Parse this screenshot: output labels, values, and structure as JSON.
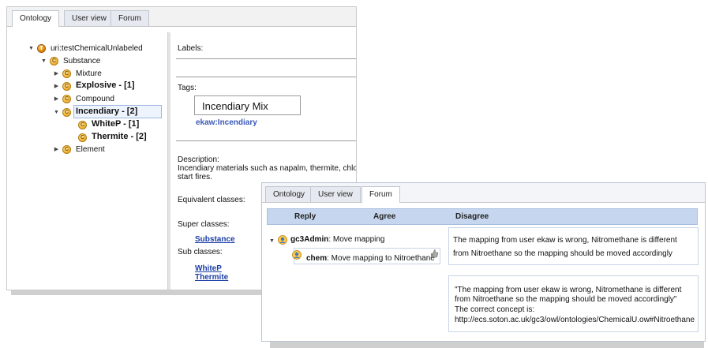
{
  "back_window": {
    "tabs": [
      "Ontology",
      "User view",
      "Forum"
    ],
    "active_tab": 0,
    "tree": {
      "root": "uri:testChemicalUnlabeled",
      "substance": "Substance",
      "items": [
        {
          "label": "Mixture",
          "expanded": false
        },
        {
          "label": "Explosive - [1]",
          "expanded": false,
          "bold": true
        },
        {
          "label": "Compound",
          "expanded": false
        },
        {
          "label": "Incendiary - [2]",
          "expanded": true,
          "bold": true,
          "selected": true
        },
        {
          "label": "WhiteP - [1]",
          "bold": true,
          "child": true
        },
        {
          "label": "Thermite - [2]",
          "bold": true,
          "child": true
        },
        {
          "label": "Element",
          "expanded": false
        }
      ]
    },
    "details": {
      "labels_title": "Labels:",
      "tags_title": "Tags:",
      "tag_input_value": "Incendiary Mix",
      "tag_link": "ekaw:Incendiary",
      "description_title": "Description:",
      "description_text_1": "Incendiary materials such as napalm, thermite, chlorir",
      "description_text_2": "start fires.",
      "equivalent_title": "Equivalent classes:",
      "super_title": "Super classes:",
      "super_link": "Substance",
      "sub_title": "Sub classes:",
      "sub_links": [
        "WhiteP",
        "Thermite"
      ]
    }
  },
  "front_window": {
    "tabs": [
      "Ontology",
      "User view",
      "Forum"
    ],
    "active_tab": 2,
    "header": {
      "reply": "Reply",
      "agree": "Agree",
      "disagree": "Disagree"
    },
    "thread": [
      {
        "user": "gc3Admin",
        "message": ": Move mapping"
      },
      {
        "user": "chem",
        "message": ": Move mapping to Nitroethane"
      }
    ],
    "comment_1": [
      "The mapping from user ekaw is wrong, Nitromethane is different",
      "from Nitroethane so the mapping should be moved accordingly"
    ],
    "comment_2": [
      "\"The mapping from user ekaw is wrong, Nitromethane is different",
      "from Nitroethane so the mapping should be moved accordingly\"",
      "The correct concept is:",
      "http://ecs.soton.ac.uk/gc3/owl/ontologies/ChemicalU.ow#Nitroethane"
    ]
  },
  "colors": {
    "link": "#1b3ea6",
    "header_bg": "#c5d6ee",
    "tab_bg": "#e6eaf0"
  }
}
